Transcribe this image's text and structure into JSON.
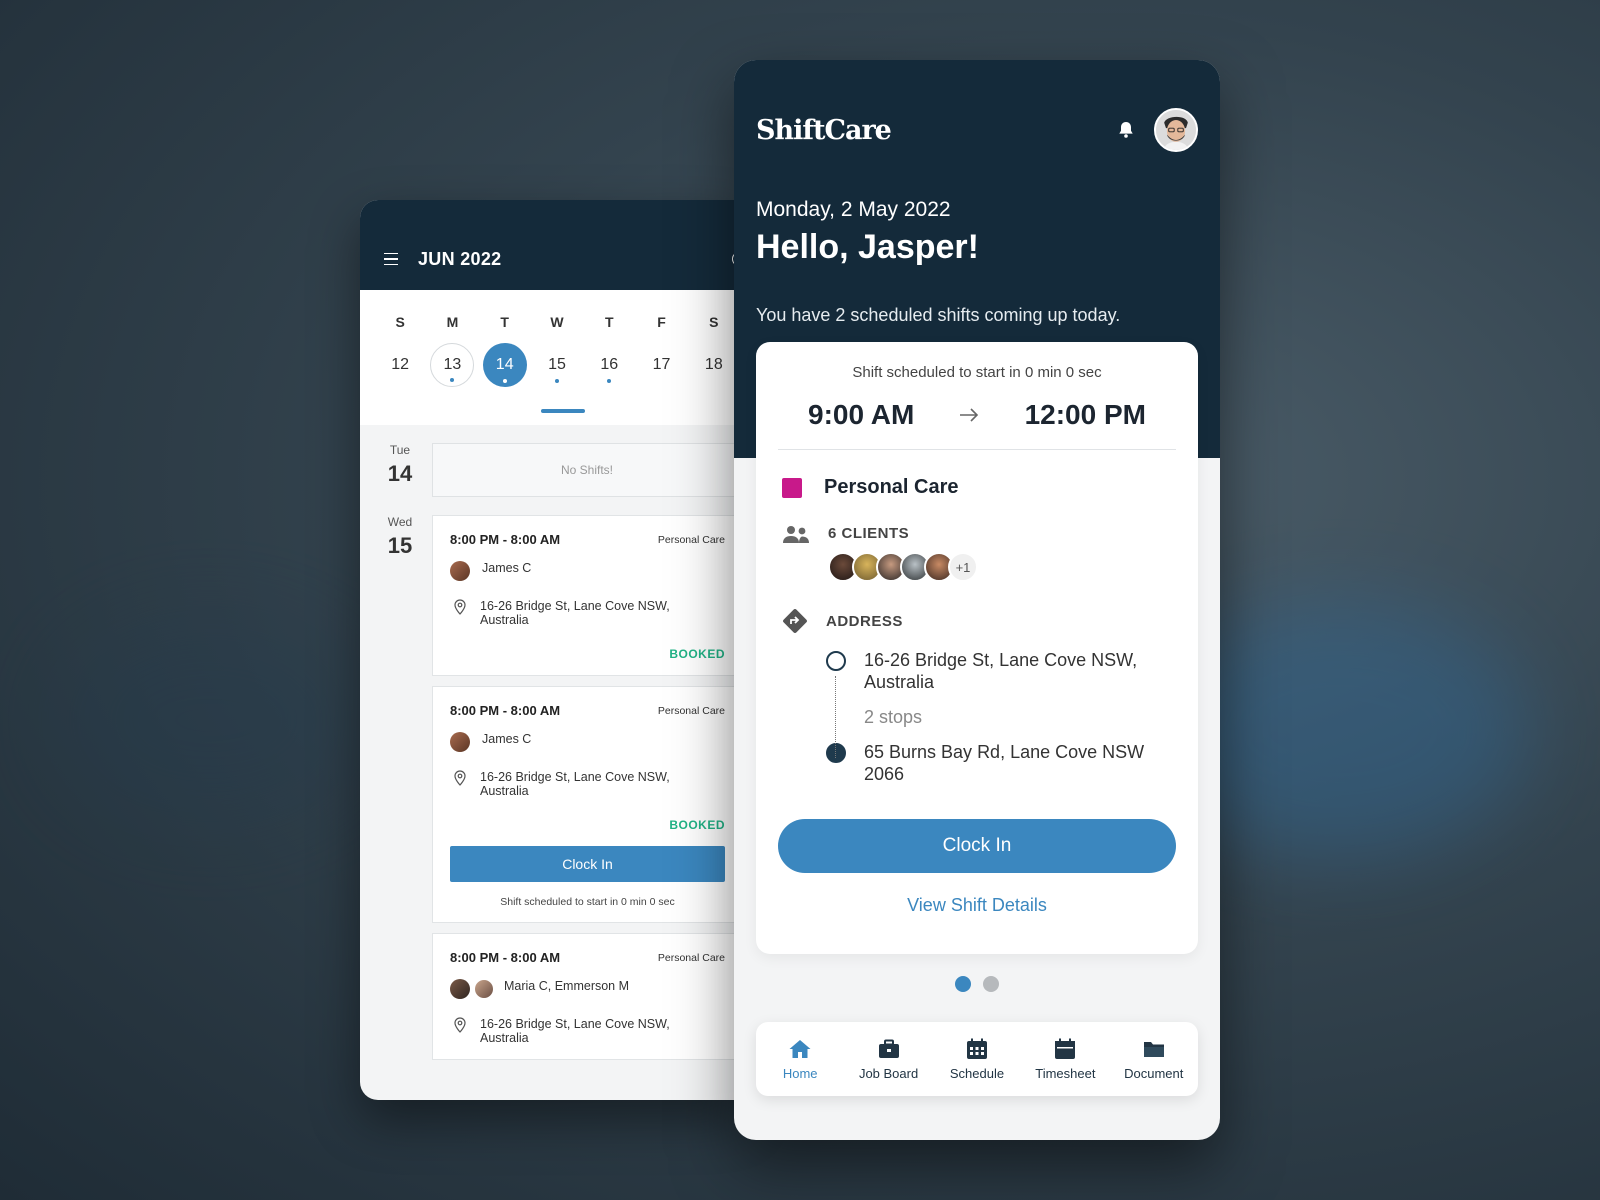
{
  "calendar": {
    "month_label": "JUN 2022",
    "weekdays": [
      "S",
      "M",
      "T",
      "W",
      "T",
      "F",
      "S"
    ],
    "dates": [
      "12",
      "13",
      "14",
      "15",
      "16",
      "17",
      "18"
    ],
    "selected_date": "14",
    "agenda": [
      {
        "day_name": "Tue",
        "day_num": "14",
        "empty_text": "No Shifts!"
      },
      {
        "day_name": "Wed",
        "day_num": "15"
      }
    ],
    "shifts": [
      {
        "time": "8:00 PM - 8:00 AM",
        "type": "Personal Care",
        "client": "James C",
        "address_line1": "16-26 Bridge St, Lane Cove NSW,",
        "address_line2": "Australia",
        "status": "BOOKED"
      },
      {
        "time": "8:00 PM - 8:00 AM",
        "type": "Personal Care",
        "client": "James C",
        "address_line1": "16-26 Bridge St, Lane Cove NSW,",
        "address_line2": "Australia",
        "status": "BOOKED",
        "button": "Clock In",
        "note": "Shift scheduled to start in 0 min 0 sec"
      },
      {
        "time": "8:00 PM - 8:00 AM",
        "type": "Personal Care",
        "client": "Maria C, Emmerson M",
        "address_line1": "16-26 Bridge St, Lane Cove NSW,",
        "address_line2": "Australia"
      }
    ]
  },
  "home": {
    "brand": "ShiftCare",
    "date": "Monday, 2 May 2022",
    "greeting": "Hello, Jasper!",
    "summary": "You have 2 scheduled shifts coming up today.",
    "card": {
      "countdown": "Shift scheduled to start in 0 min 0 sec",
      "start": "9:00 AM",
      "end": "12:00 PM",
      "service": "Personal Care",
      "service_color": "#c8198a",
      "clients_label": "6 CLIENTS",
      "clients_more": "+1",
      "address_label": "ADDRESS",
      "from_line1": "16-26 Bridge St, Lane Cove NSW,",
      "from_line2": "Australia",
      "stops": "2 stops",
      "to_line1": "65 Burns Bay Rd, Lane Cove NSW",
      "to_line2": "2066",
      "clock_in": "Clock In",
      "view_details": "View Shift Details"
    },
    "tabs": [
      {
        "label": "Home",
        "icon": "home-icon"
      },
      {
        "label": "Job Board",
        "icon": "briefcase-icon"
      },
      {
        "label": "Schedule",
        "icon": "calendar-icon"
      },
      {
        "label": "Timesheet",
        "icon": "timesheet-icon"
      },
      {
        "label": "Document",
        "icon": "folder-icon"
      }
    ]
  },
  "colors": {
    "accent": "#3b87bf",
    "header": "#142a3a",
    "booked": "#21b386"
  }
}
